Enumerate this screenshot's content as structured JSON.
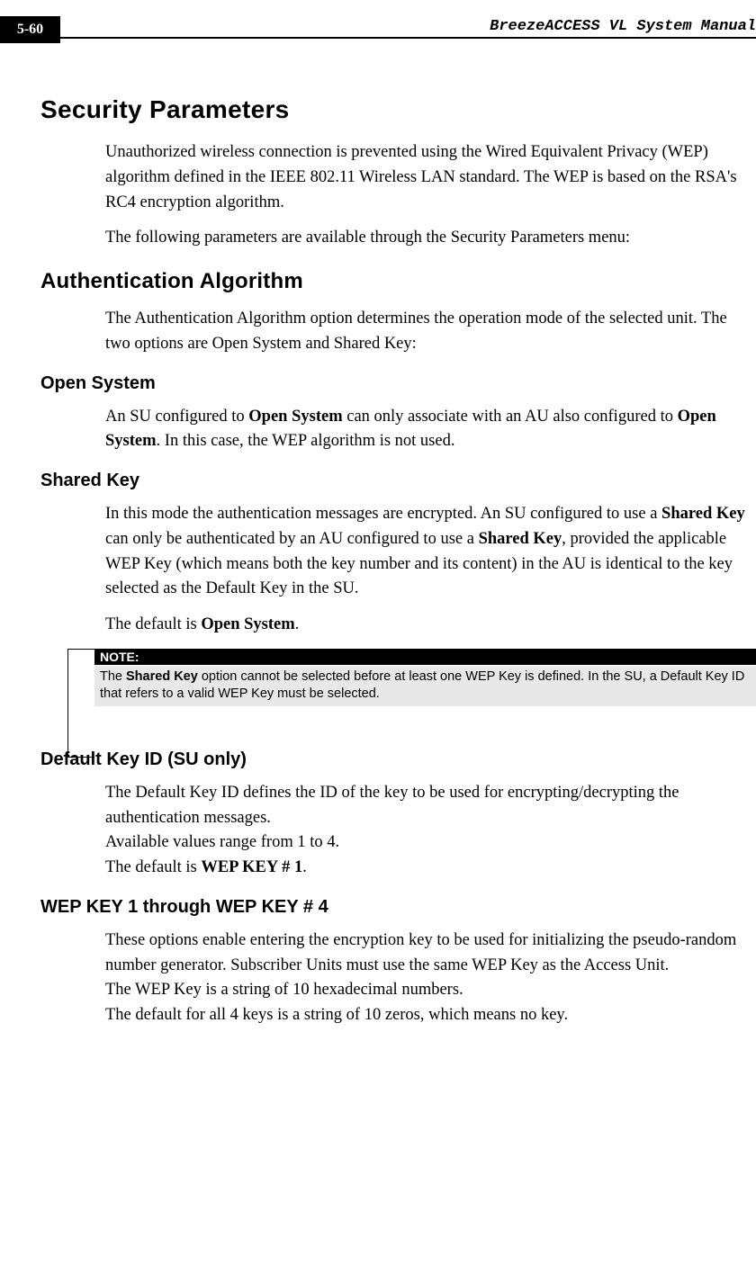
{
  "header": {
    "page_number": "5-60",
    "doc_title": "BreezeACCESS VL System Manual"
  },
  "h1": "Security Parameters",
  "p1": "Unauthorized wireless connection is prevented using the Wired Equivalent Privacy (WEP) algorithm defined in the IEEE 802.11 Wireless LAN standard. The WEP is based on the RSA's RC4 encryption algorithm.",
  "p2": "The following parameters are available through the Security Parameters menu:",
  "h2_auth": "Authentication Algorithm",
  "p3": "The Authentication Algorithm option determines the operation mode of the selected unit. The two options are Open System and Shared Key:",
  "h3_open": "Open System",
  "p4_pre": "An SU configured to ",
  "p4_b1": "Open System",
  "p4_mid": " can only associate with an AU also configured to ",
  "p4_b2": "Open System",
  "p4_post": ". In this case, the WEP algorithm is not used.",
  "h3_shared": "Shared Key",
  "p5_pre": "In this mode the authentication messages are encrypted. An SU configured to use a ",
  "p5_b1": "Shared Key",
  "p5_mid1": " can only be authenticated by an AU configured to use a ",
  "p5_b2": "Shared Key",
  "p5_post": ", provided the applicable WEP Key (which means both the key number and its content) in the AU is identical to the key selected as the Default Key in the SU.",
  "p6_pre": "The default is ",
  "p6_b": "Open System",
  "p6_post": ".",
  "note": {
    "label": "NOTE:",
    "pre": "The ",
    "bold": "Shared Key",
    "post": " option cannot be selected before at least one WEP Key is defined. In the SU, a Default Key ID that refers to a valid WEP Key must be selected."
  },
  "h3_default": "Default Key ID (SU only)",
  "p7_l1": "The Default Key ID defines the ID of the key to be used for encrypting/decrypting the authentication messages.",
  "p7_l2": "Available values range from 1 to 4.",
  "p7_l3_pre": "The default is ",
  "p7_l3_b": "WEP KEY # 1",
  "p7_l3_post": ".",
  "h3_wep": "WEP KEY 1 through WEP KEY # 4",
  "p8_l1": "These options enable entering the encryption key to be used for initializing the pseudo-random number generator. Subscriber Units must use the same WEP Key as the Access Unit.",
  "p8_l2": "The WEP Key is a string of 10 hexadecimal numbers.",
  "p8_l3": "The default for all 4 keys is a string of 10 zeros, which means no key."
}
